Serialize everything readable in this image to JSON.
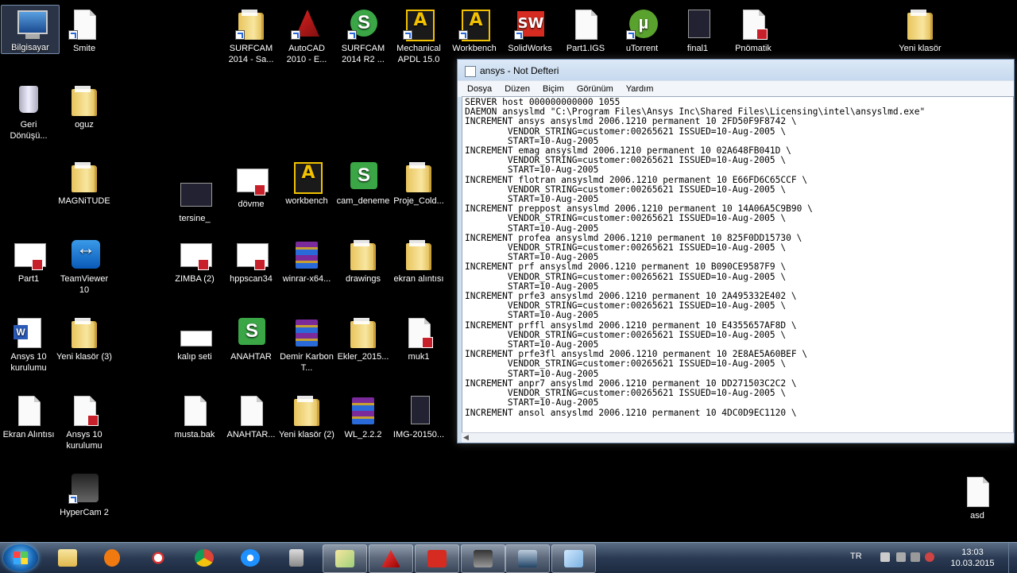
{
  "desktop": {
    "icons": {
      "bilgisayar": "Bilgisayar",
      "smite": "Smite",
      "surfcam2014sa": "SURFCAM 2014 - Sa...",
      "autocad": "AutoCAD 2010 - E...",
      "surfcam2014r2": "SURFCAM 2014 R2 ...",
      "mechanical": "Mechanical APDL 15.0",
      "workbench": "Workbench",
      "solidworks": "SolidWorks",
      "part1igs": "Part1.IGS",
      "utorrent": "uTorrent",
      "final1": "final1",
      "pnomatik": "Pnömatik",
      "yeniklasor_top": "Yeni klasör",
      "geri": "Geri Dönüşü...",
      "oguz": "oguz",
      "magnitude": "MAGNiTUDE",
      "tersine": "tersine_",
      "dovme": "dövme",
      "workbench2": "workbench",
      "cam_deneme": "cam_deneme",
      "proje": "Proje_Cold...",
      "part1": "Part1",
      "teamviewer": "TeamViewer 10",
      "zimba": "ZIMBA (2)",
      "hppscan": "hppscan34",
      "winrar": "winrar-x64...",
      "drawings": "drawings",
      "ekran_alintisi_f": "ekran alıntısı",
      "ansys_kur1": "Ansys 10 kurulumu",
      "yeniklasor3": "Yeni klasör (3)",
      "kalip": "kalıp seti",
      "anahtar": "ANAHTAR",
      "demir": "Demir Karbon T...",
      "ekler": "Ekler_2015...",
      "muk1": "muk1",
      "ekran_alintisi": "Ekran Alıntısı",
      "ansys_kur2": "Ansys 10 kurulumu",
      "musta": "musta.bak",
      "anahtar2": "ANAHTAR...",
      "yeniklasor2": "Yeni klasör (2)",
      "wl": "WL_2.2.2",
      "img": "IMG-20150...",
      "hypercam": "HyperCam 2",
      "asd": "asd"
    }
  },
  "notepad": {
    "title": "ansys - Not Defteri",
    "menu": [
      "Dosya",
      "Düzen",
      "Biçim",
      "Görünüm",
      "Yardım"
    ],
    "content": "SERVER host 000000000000 1055\nDAEMON ansyslmd \"C:\\Program Files\\Ansys Inc\\Shared Files\\Licensing\\intel\\ansyslmd.exe\"\nINCREMENT ansys ansyslmd 2006.1210 permanent 10 2FD50F9F8742 \\\n        VENDOR_STRING=customer:00265621 ISSUED=10-Aug-2005 \\\n        START=10-Aug-2005\nINCREMENT emag ansyslmd 2006.1210 permanent 10 02A648FB041D \\\n        VENDOR_STRING=customer:00265621 ISSUED=10-Aug-2005 \\\n        START=10-Aug-2005\nINCREMENT flotran ansyslmd 2006.1210 permanent 10 E66FD6C65CCF \\\n        VENDOR_STRING=customer:00265621 ISSUED=10-Aug-2005 \\\n        START=10-Aug-2005\nINCREMENT preppost ansyslmd 2006.1210 permanent 10 14A06A5C9B90 \\\n        VENDOR_STRING=customer:00265621 ISSUED=10-Aug-2005 \\\n        START=10-Aug-2005\nINCREMENT profea ansyslmd 2006.1210 permanent 10 825F0DD15730 \\\n        VENDOR_STRING=customer:00265621 ISSUED=10-Aug-2005 \\\n        START=10-Aug-2005\nINCREMENT prf ansyslmd 2006.1210 permanent 10 B090CE9587F9 \\\n        VENDOR_STRING=customer:00265621 ISSUED=10-Aug-2005 \\\n        START=10-Aug-2005\nINCREMENT prfe3 ansyslmd 2006.1210 permanent 10 2A495332E402 \\\n        VENDOR_STRING=customer:00265621 ISSUED=10-Aug-2005 \\\n        START=10-Aug-2005\nINCREMENT prffl ansyslmd 2006.1210 permanent 10 E4355657AF8D \\\n        VENDOR_STRING=customer:00265621 ISSUED=10-Aug-2005 \\\n        START=10-Aug-2005\nINCREMENT prfe3fl ansyslmd 2006.1210 permanent 10 2E8AE5A60BEF \\\n        VENDOR_STRING=customer:00265621 ISSUED=10-Aug-2005 \\\n        START=10-Aug-2005\nINCREMENT anpr7 ansyslmd 2006.1210 permanent 10 DD271503C2C2 \\\n        VENDOR_STRING=customer:00265621 ISSUED=10-Aug-2005 \\\n        START=10-Aug-2005\nINCREMENT ansol ansyslmd 2006.1210 permanent 10 4DC0D9EC1120 \\"
  },
  "taskbar": {
    "lang": "TR",
    "time": "13:03",
    "date": "10.03.2015",
    "icons": [
      "folder-icon",
      "media-player-icon",
      "snipping-tool-icon",
      "chrome-icon",
      "ie-icon",
      "calculator-icon",
      "explorer-icon",
      "autocad-icon",
      "solidworks-icon",
      "hypercam-icon",
      "ansys-icon",
      "notepad-icon"
    ]
  }
}
